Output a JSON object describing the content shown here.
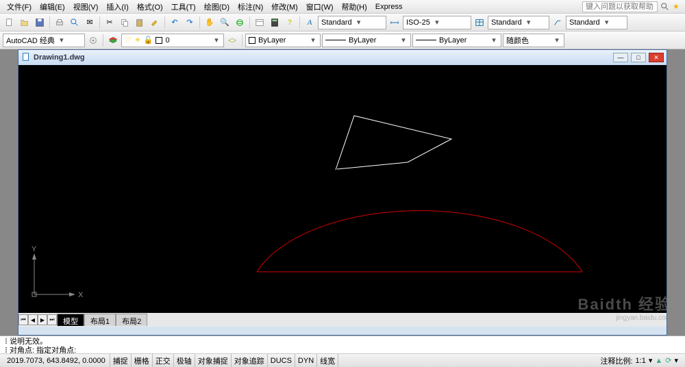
{
  "menu": [
    "文件(F)",
    "编辑(E)",
    "视图(V)",
    "插入(I)",
    "格式(O)",
    "工具(T)",
    "绘图(D)",
    "标注(N)",
    "修改(M)",
    "窗口(W)",
    "帮助(H)",
    "Express"
  ],
  "search_help_placeholder": "键入问题以获取帮助",
  "workspace": "AutoCAD 经典",
  "style_combo1": "Standard",
  "style_combo2": "ISO-25",
  "style_combo3": "Standard",
  "style_combo4": "Standard",
  "layer_current": "0",
  "color_label": "ByLayer",
  "linetype": "ByLayer",
  "lineweight": "ByLayer",
  "plotcolor": "随颜色",
  "doc_title": "Drawing1.dwg",
  "ucs_y": "Y",
  "ucs_x": "X",
  "tabs": [
    "模型",
    "布局1",
    "布局2"
  ],
  "active_tab": 0,
  "cmd_history": "说明无效。",
  "cmd_prompt": "对角点: 指定对角点:",
  "status": {
    "coords": "2019.7073, 643.8492, 0.0000",
    "buttons": [
      "捕捉",
      "栅格",
      "正交",
      "极轴",
      "对象捕捉",
      "对象追踪",
      "DUCS",
      "DYN",
      "线宽"
    ],
    "anno_label": "注释比例:",
    "anno_scale": "1:1"
  },
  "watermark": {
    "big": "Baidth 经验",
    "sm": "jingyan.baidu.com"
  },
  "icons": {
    "new": "▫",
    "open": "⌂",
    "save": "💾",
    "plot": "⎙",
    "cut": "✂",
    "copy": "⧉",
    "paste": "📋",
    "undo": "↶",
    "redo": "↷"
  }
}
